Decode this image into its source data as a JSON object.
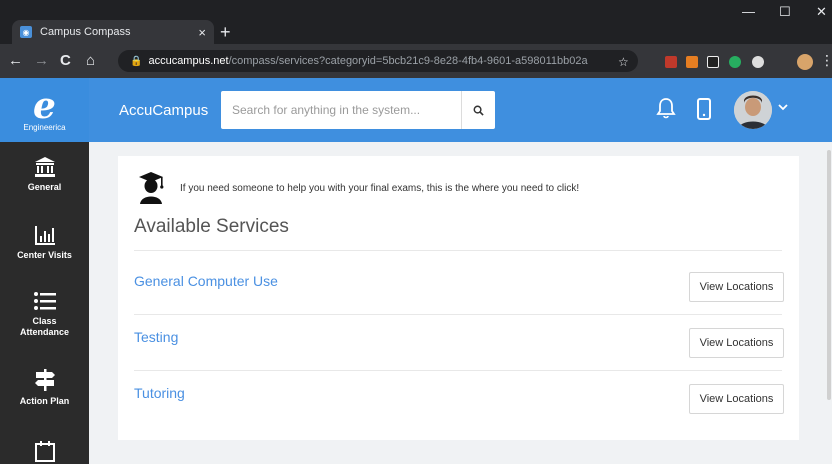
{
  "browser": {
    "tab_title": "Campus Compass",
    "tab_close": "×",
    "new_tab": "+",
    "url_host": "accucampus.net",
    "url_path": "/compass/services?categoryid=5bcb21c9-8e28-4fb4-9601-a598011bb02a",
    "window_controls": {
      "minimize": "—",
      "maximize": "☐",
      "close": "✕"
    },
    "nav": {
      "back": "←",
      "forward": "→",
      "reload": "C",
      "home": "⌂"
    }
  },
  "sidebar": {
    "logo_letter": "e",
    "logo_text": "Engineerica",
    "items": [
      {
        "label": "General",
        "icon": "bank-icon"
      },
      {
        "label": "Center Visits",
        "icon": "bar-chart-icon"
      },
      {
        "label": "Class Attendance",
        "icon": "list-icon"
      },
      {
        "label": "Action Plan",
        "icon": "signpost-icon"
      },
      {
        "label": "",
        "icon": "calendar-icon"
      }
    ]
  },
  "topbar": {
    "brand": "AccuCampus",
    "search_placeholder": "Search for anything in the system..."
  },
  "main": {
    "notice": "If you need someone to help you with your final exams, this is the where you need to click!",
    "heading": "Available Services",
    "services": [
      {
        "name": "General Computer Use",
        "button": "View Locations"
      },
      {
        "name": "Testing",
        "button": "View Locations"
      },
      {
        "name": "Tutoring",
        "button": "View Locations"
      }
    ]
  },
  "colors": {
    "accent": "#3f8fdf",
    "sidebar_bg": "#2b2b2b",
    "link": "#4a90e2"
  }
}
